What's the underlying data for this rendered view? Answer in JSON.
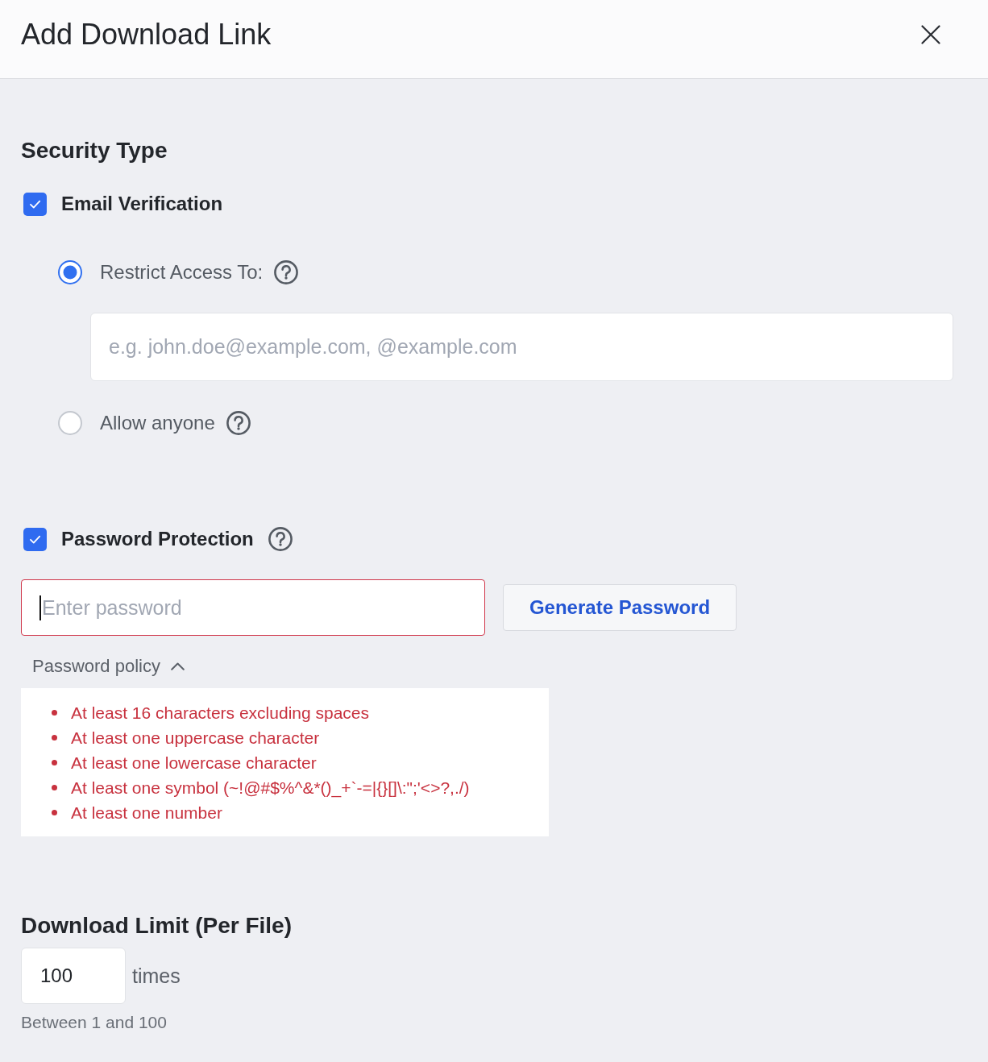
{
  "dialog": {
    "title": "Add Download Link"
  },
  "security_type": {
    "heading": "Security Type",
    "email_verification": {
      "label": "Email Verification",
      "checked": true,
      "options": [
        {
          "label": "Restrict Access To:",
          "selected": true,
          "help": true,
          "field": {
            "placeholder": "e.g. john.doe@example.com, @example.com"
          }
        },
        {
          "label": "Allow anyone",
          "selected": false,
          "help": true
        }
      ]
    },
    "password_protection": {
      "label": "Password Protection",
      "checked": true,
      "help": true,
      "field": {
        "placeholder": "Enter password",
        "invalid": true,
        "focused": true
      },
      "generate_button": "Generate Password",
      "policy": {
        "label": "Password policy",
        "expanded": true,
        "rules": [
          "At least 16 characters excluding spaces",
          "At least one uppercase character",
          "At least one lowercase character",
          "At least one symbol (~!@#$%^&*()_+`-=|{}[]\\:\";'<>?,./)",
          "At least one number"
        ]
      }
    }
  },
  "download_limit": {
    "heading": "Download Limit (Per File)",
    "value": "100",
    "unit": "times",
    "hint": "Between 1 and 100"
  }
}
